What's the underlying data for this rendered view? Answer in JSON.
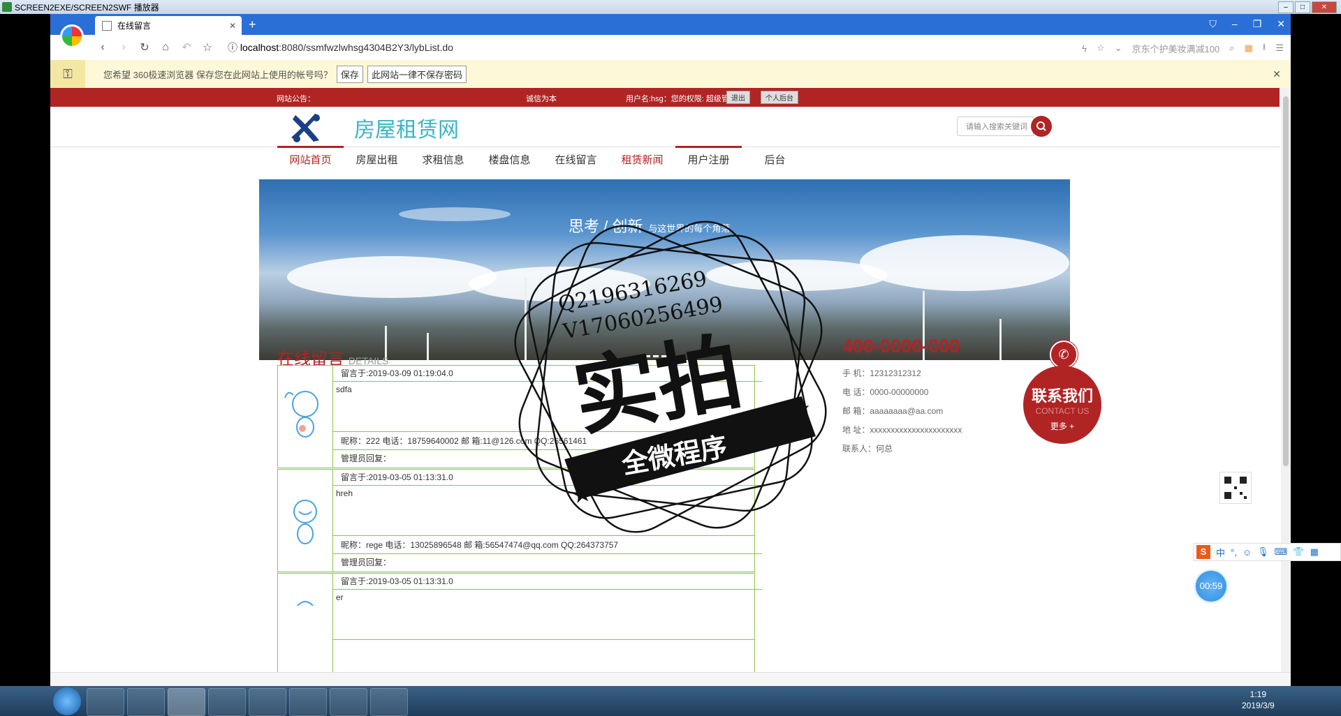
{
  "player": {
    "title": "SCREEN2EXE/SCREEN2SWF 播放器"
  },
  "browser": {
    "tab_title": "在线留言",
    "url_host": "localhost",
    "url_rest": ":8080/ssmfwzlwhsg4304B2Y3/lybList.do",
    "search_hint": "京东个护美妆满减100",
    "password_prompt": "您希望 360极速浏览器 保存您在此网站上使用的帐号吗？",
    "save_label": "保存",
    "never_save_label": "此网站一律不保存密码"
  },
  "site": {
    "notice_label": "网站公告：",
    "motto": "诚信为本",
    "user_info": "用户名:hsg：您的权限: 超级管理员",
    "logout_label": "退出",
    "backend_label": "个人后台",
    "title": "房屋租赁网",
    "search_placeholder": "请输入搜索关键词",
    "menu": [
      {
        "label": "网站首页"
      },
      {
        "label": "房屋出租"
      },
      {
        "label": "求租信息"
      },
      {
        "label": "楼盘信息"
      },
      {
        "label": "在线留言"
      },
      {
        "label": "租赁新闻"
      },
      {
        "label": "用户注册"
      },
      {
        "label": "后台"
      }
    ],
    "banner_slogan": "思考 / 创新",
    "banner_sub": "与这世界的每个角落"
  },
  "messages": {
    "title": "在线留言",
    "subtitle": "DETAILS",
    "items": [
      {
        "time": "留言于:2019-03-09 01:19:04.0",
        "content": "sdfa",
        "meta": "昵称：222    电话：18759640002  邮 箱:11@126.com    QQ:26561461",
        "reply": "管理员回复："
      },
      {
        "time": "留言于:2019-03-05 01:13:31.0",
        "content": "hreh",
        "meta": "昵称：rege    电话：13025896548  邮 箱:56547474@qq.com    QQ:264373757",
        "reply": "管理员回复："
      },
      {
        "time": "留言于:2019-03-05 01:13:31.0",
        "content": "er",
        "meta": "",
        "reply": ""
      }
    ]
  },
  "contact": {
    "tel": "400-0000-000",
    "mobile": "手  机：12312312312",
    "phone": "电  话：0000-00000000",
    "email": "邮  箱：aaaaaaaa@aa.com",
    "address": "地  址：xxxxxxxxxxxxxxxxxxxxxx",
    "person": "联系人：何总",
    "badge_title": "联系我们",
    "badge_en": "CONTACT US",
    "badge_more": "更多 +"
  },
  "watermark": {
    "q": "Q2196316269",
    "v": "V17060256499",
    "big": "实拍",
    "ribbon": "全微程序"
  },
  "overlay": {
    "timer": "00:59"
  },
  "ime": {
    "lang": "中"
  },
  "taskbar": {
    "time": "1:19",
    "date": "2019/3/9"
  }
}
